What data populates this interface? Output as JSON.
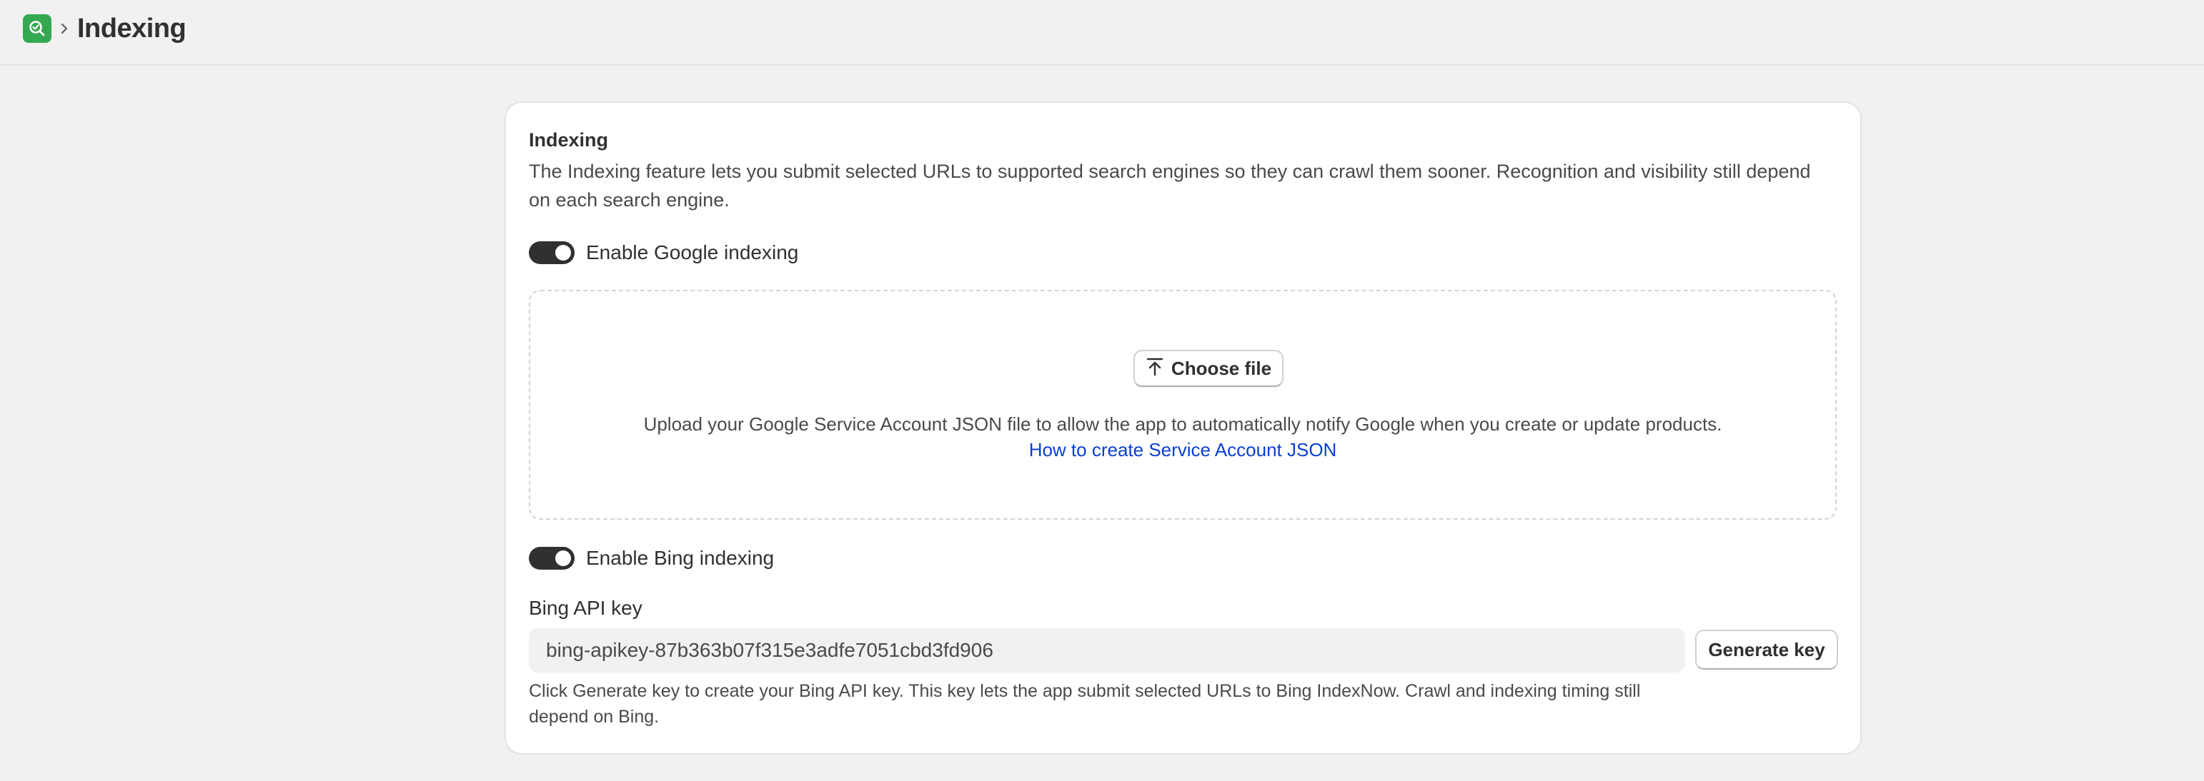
{
  "header": {
    "title": "Indexing",
    "app_icon": "search-check-icon",
    "separator_icon": "chevron-right-icon"
  },
  "colors": {
    "app_icon_bg": "#35a852",
    "link": "#0a3fd1",
    "toggle_on": "#303030"
  },
  "card": {
    "title": "Indexing",
    "description": "The Indexing feature lets you submit selected URLs to supported search engines so they can crawl them sooner. Recognition and visibility still depend on each search engine.",
    "google": {
      "toggle_label": "Enable Google indexing",
      "enabled": true,
      "upload_button_label": "Choose file",
      "upload_icon": "upload-icon",
      "upload_help": "Upload your Google Service Account JSON file to allow the app to automatically notify Google when you create or update products.",
      "help_link_label": "How to create Service Account JSON"
    },
    "bing": {
      "toggle_label": "Enable Bing indexing",
      "enabled": true,
      "api_key_label": "Bing API key",
      "api_key_value": "bing-apikey-87b363b07f315e3adfe7051cbd3fd906",
      "generate_button_label": "Generate key",
      "help_text": "Click Generate key to create your Bing API key. This key lets the app submit selected URLs to Bing IndexNow. Crawl and indexing timing still depend on Bing."
    }
  }
}
